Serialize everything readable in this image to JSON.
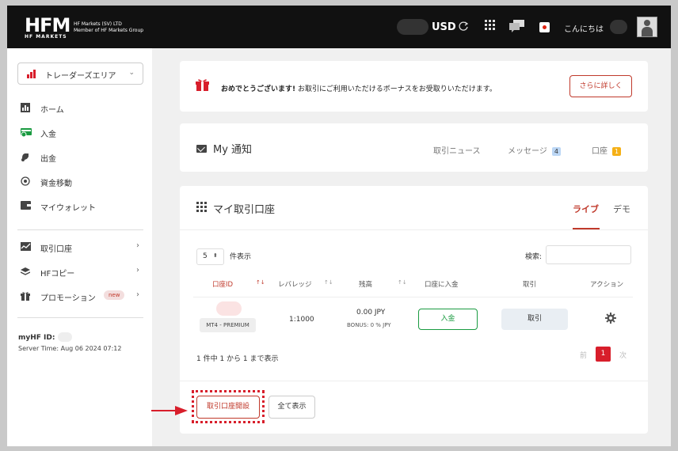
{
  "header": {
    "logo_text": "HFM",
    "logo_sub": "HF MARKETS",
    "corp_line1": "HF Markets (SV) LTD",
    "corp_line2": "Member of HF Markets Group",
    "currency": "USD",
    "greeting": "こんにちは",
    "icons": [
      "refresh-icon",
      "apps-grid-icon",
      "chat-icon",
      "japan-flag-icon",
      "user-avatar-icon"
    ]
  },
  "sidebar": {
    "area_label": "トレーダーズエリア",
    "items": [
      {
        "label": "ホーム",
        "icon": "chart-icon"
      },
      {
        "label": "入金",
        "icon": "deposit-icon"
      },
      {
        "label": "出金",
        "icon": "withdraw-icon"
      },
      {
        "label": "資金移動",
        "icon": "transfer-icon"
      },
      {
        "label": "マイウォレット",
        "icon": "wallet-icon"
      },
      {
        "label": "取引口座",
        "icon": "trading-account-icon"
      },
      {
        "label": "HFコピー",
        "icon": "copy-icon"
      },
      {
        "label": "プロモーション",
        "icon": "gift-icon",
        "badge": "new"
      }
    ],
    "myhf_label": "myHF ID:",
    "server_time": "Server Time: Aug 06 2024 07:12"
  },
  "notice": {
    "bold": "おめでとうございます!",
    "text": " お取引にご利用いただけるボーナスをお受取りいただけます。",
    "button": "さらに詳しく"
  },
  "notifications": {
    "title": "My 通知",
    "tabs": [
      {
        "label": "取引ニュース"
      },
      {
        "label": "メッセージ",
        "count": "4"
      },
      {
        "label": "口座",
        "count": "1"
      }
    ]
  },
  "accounts": {
    "title": "マイ取引口座",
    "tab_live": "ライブ",
    "tab_demo": "デモ",
    "page_size": "5",
    "page_size_label": "件表示",
    "search_label": "検索:",
    "search_value": "",
    "columns": [
      "口座ID",
      "レバレッジ",
      "残高",
      "口座に入金",
      "取引",
      "アクション"
    ],
    "row": {
      "type": "MT4 - PREMIUM",
      "leverage": "1:1000",
      "balance": "0.00 JPY",
      "bonus": "BONUS: 0 % JPY",
      "deposit": "入金",
      "trade": "取引"
    },
    "summary": "1 件中 1 から 1 まで表示",
    "prev": "前",
    "current_page": "1",
    "next": "次",
    "open_account": "取引口座開設",
    "show_all": "全て表示"
  },
  "colors": {
    "brand_red": "#d81e2b",
    "green": "#1a9b41",
    "topbar": "#111111"
  }
}
